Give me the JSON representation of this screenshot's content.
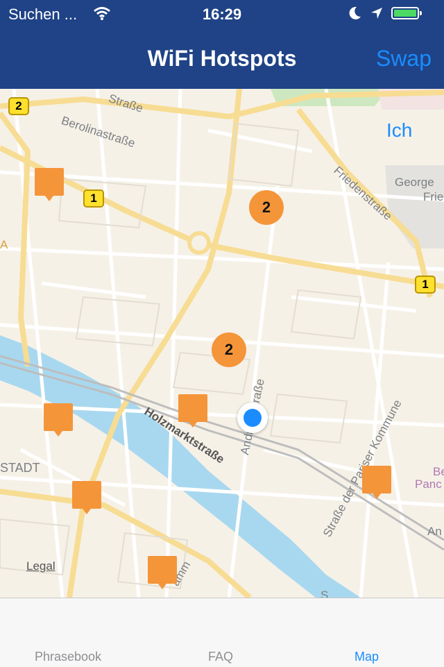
{
  "status_bar": {
    "carrier": "Suchen ...",
    "time": "16:29"
  },
  "nav": {
    "title": "WiFi Hotspots",
    "swap_label": "Swap"
  },
  "map": {
    "me_label": "Ich",
    "legal_label": "Legal",
    "clusters": [
      "2",
      "2"
    ],
    "road_shields": [
      "2",
      "1",
      "1"
    ],
    "street_labels": [
      "Straße",
      "Berolinastraße",
      "Friedenstraße",
      "Holzmarktstraße",
      "Andreasstraße",
      "Straße der Pariser Kommune",
      "STADT",
      "A",
      "George",
      "Frie",
      "Be",
      "Panc",
      "An",
      "amm",
      "S"
    ]
  },
  "tabs": [
    {
      "label": "Phrasebook",
      "active": false
    },
    {
      "label": "FAQ",
      "active": false
    },
    {
      "label": "Map",
      "active": true
    }
  ],
  "colors": {
    "nav_bar": "#1f4386",
    "accent": "#1a8cff",
    "hotspot": "#f4953a",
    "river": "#a8d8ef",
    "park": "#cde8c0"
  }
}
